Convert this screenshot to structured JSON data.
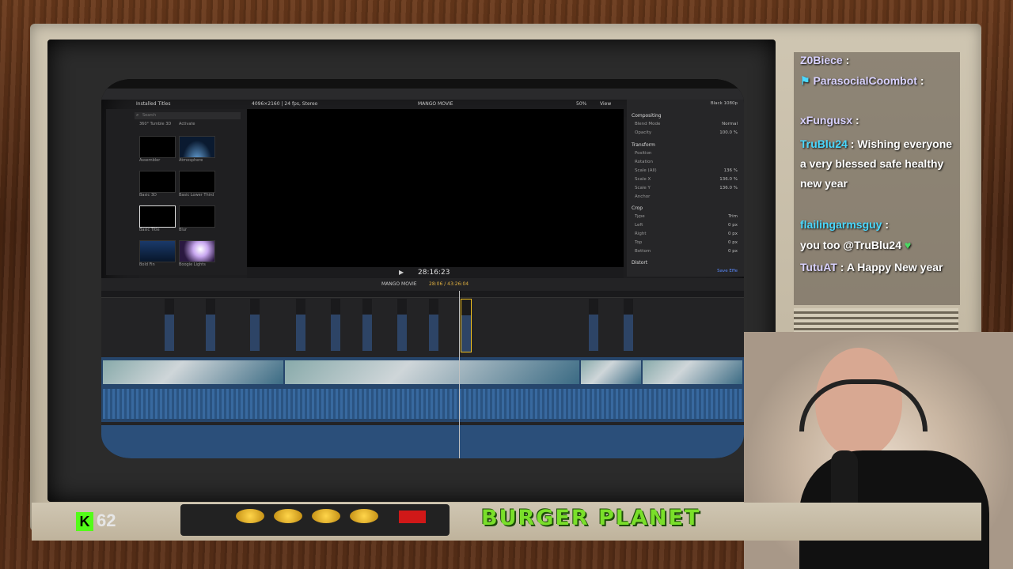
{
  "fcp": {
    "browser": {
      "header": "Installed Titles",
      "search_placeholder": "Search",
      "top_labels": [
        "360° Tumble 3D",
        "Activate"
      ],
      "thumbnails": [
        {
          "label": "Assembler"
        },
        {
          "label": "Atmosphere"
        },
        {
          "label": "Basic 3D"
        },
        {
          "label": "Basic Lower Third"
        },
        {
          "label": "Basic Title"
        },
        {
          "label": "Blur"
        },
        {
          "label": "Bold Fin"
        },
        {
          "label": "Boogie Lights"
        }
      ]
    },
    "viewer": {
      "format": "4096×2160 | 24 fps, Stereo",
      "project_title": "MANGO MOVIE",
      "zoom": "50%",
      "view_menu": "View",
      "timecode": "28:16:23"
    },
    "inspector": {
      "title": "Black 1080p",
      "sections": {
        "compositing": "Compositing",
        "blend_mode_label": "Blend Mode",
        "blend_mode_value": "Normal",
        "opacity_label": "Opacity",
        "opacity_value": "100.0 %",
        "transform": "Transform",
        "position_label": "Position",
        "rotation_label": "Rotation",
        "scale_all_label": "Scale (All)",
        "scale_all_value": "136 %",
        "scale_x_label": "Scale X",
        "scale_x_value": "136.0 %",
        "scale_y_label": "Scale Y",
        "scale_y_value": "136.0 %",
        "anchor_label": "Anchor",
        "crop": "Crop",
        "type_label": "Type",
        "type_value": "Trim",
        "left_label": "Left",
        "right_label": "Right",
        "top_label": "Top",
        "bottom_label": "Bottom",
        "zero_px": "0 px",
        "distort": "Distort",
        "save_effects": "Save Effe"
      }
    },
    "timeline": {
      "project_name": "MANGO MOVIE",
      "duration": "28:06 / 43:26:04"
    }
  },
  "chat": {
    "lines": [
      {
        "user": "Z0Biece",
        "text": ""
      },
      {
        "user": "ParasocialCoombot",
        "text": ""
      },
      {
        "user": "xFungusx",
        "text": ""
      },
      {
        "user": "TruBlu24",
        "text": "Wishing everyone a very blessed safe healthy new year"
      },
      {
        "user": "flailingarmsguy",
        "text": "you too @TruBlu24"
      },
      {
        "user": "TutuAT",
        "text": "A Happy New year"
      }
    ]
  },
  "overlay": {
    "kick_viewers": "62",
    "brand": "BURGER PLANET"
  }
}
